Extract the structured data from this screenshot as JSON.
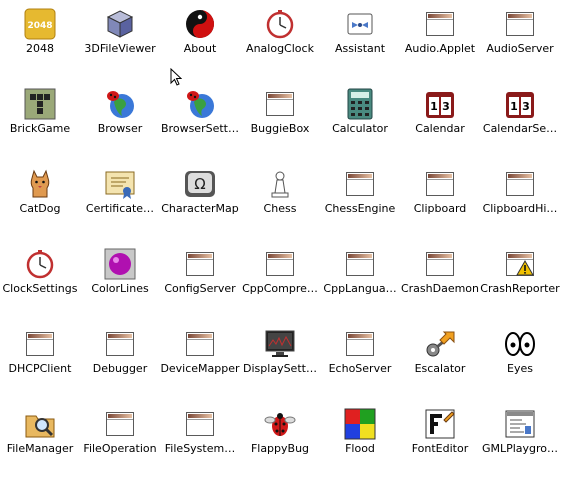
{
  "desktop": {
    "icons": [
      {
        "label": "2048",
        "icon": "2048-icon"
      },
      {
        "label": "3DFileViewer",
        "icon": "cube-icon"
      },
      {
        "label": "About",
        "icon": "about-ball-icon"
      },
      {
        "label": "AnalogClock",
        "icon": "clock-icon"
      },
      {
        "label": "Assistant",
        "icon": "assistant-icon"
      },
      {
        "label": "Audio.Applet",
        "icon": "window-icon"
      },
      {
        "label": "AudioServer",
        "icon": "window-icon"
      },
      {
        "label": "BrickGame",
        "icon": "brick-game-icon"
      },
      {
        "label": "Browser",
        "icon": "globe-ladybug-icon"
      },
      {
        "label": "BrowserSett…",
        "icon": "globe-ladybug-icon"
      },
      {
        "label": "BuggieBox",
        "icon": "window-icon"
      },
      {
        "label": "Calculator",
        "icon": "calculator-icon"
      },
      {
        "label": "Calendar",
        "icon": "calendar-icon"
      },
      {
        "label": "CalendarSe…",
        "icon": "calendar-icon"
      },
      {
        "label": "CatDog",
        "icon": "catdog-icon"
      },
      {
        "label": "Certificate…",
        "icon": "certificate-icon"
      },
      {
        "label": "CharacterMap",
        "icon": "character-map-icon"
      },
      {
        "label": "Chess",
        "icon": "chess-pawn-icon"
      },
      {
        "label": "ChessEngine",
        "icon": "window-icon"
      },
      {
        "label": "Clipboard",
        "icon": "window-icon"
      },
      {
        "label": "ClipboardHi…",
        "icon": "window-icon"
      },
      {
        "label": "ClockSettings",
        "icon": "clock-icon"
      },
      {
        "label": "ColorLines",
        "icon": "color-lines-icon"
      },
      {
        "label": "ConfigServer",
        "icon": "window-icon"
      },
      {
        "label": "CppCompre…",
        "icon": "window-icon"
      },
      {
        "label": "CppLangua…",
        "icon": "window-icon"
      },
      {
        "label": "CrashDaemon",
        "icon": "window-icon"
      },
      {
        "label": "CrashReporter",
        "icon": "warning-window-icon"
      },
      {
        "label": "DHCPClient",
        "icon": "window-icon"
      },
      {
        "label": "Debugger",
        "icon": "window-icon"
      },
      {
        "label": "DeviceMapper",
        "icon": "window-icon"
      },
      {
        "label": "DisplaySett…",
        "icon": "monitor-icon"
      },
      {
        "label": "EchoServer",
        "icon": "window-icon"
      },
      {
        "label": "Escalator",
        "icon": "escalator-key-icon"
      },
      {
        "label": "Eyes",
        "icon": "eyes-icon"
      },
      {
        "label": "FileManager",
        "icon": "file-manager-icon"
      },
      {
        "label": "FileOperation",
        "icon": "window-icon"
      },
      {
        "label": "FileSystem…",
        "icon": "window-icon"
      },
      {
        "label": "FlappyBug",
        "icon": "flappy-bug-icon"
      },
      {
        "label": "Flood",
        "icon": "flood-icon"
      },
      {
        "label": "FontEditor",
        "icon": "font-editor-icon"
      },
      {
        "label": "GMLPlaygro…",
        "icon": "gml-playground-icon"
      }
    ]
  }
}
